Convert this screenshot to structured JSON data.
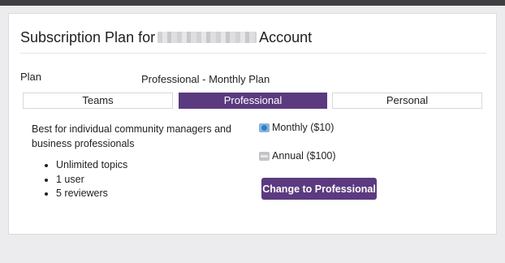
{
  "header": {
    "title_prefix": "Subscription Plan for",
    "title_suffix": "Account"
  },
  "plan": {
    "label": "Plan",
    "value": "Professional - Monthly Plan"
  },
  "tabs": [
    {
      "label": "Teams",
      "active": false
    },
    {
      "label": "Professional",
      "active": true
    },
    {
      "label": "Personal",
      "active": false
    }
  ],
  "details": {
    "description": "Best for individual community managers and business professionals",
    "features": [
      "Unlimited topics",
      "1 user",
      "5 reviewers"
    ]
  },
  "billing": {
    "monthly_label": "Monthly ($10)",
    "monthly_selected": true,
    "annual_label": "Annual ($100)",
    "annual_selected": false
  },
  "actions": {
    "change_label": "Change to Professional"
  },
  "colors": {
    "accent": "#5b3a7f",
    "page_bg": "#ececee",
    "top_bar": "#3f3f43"
  }
}
